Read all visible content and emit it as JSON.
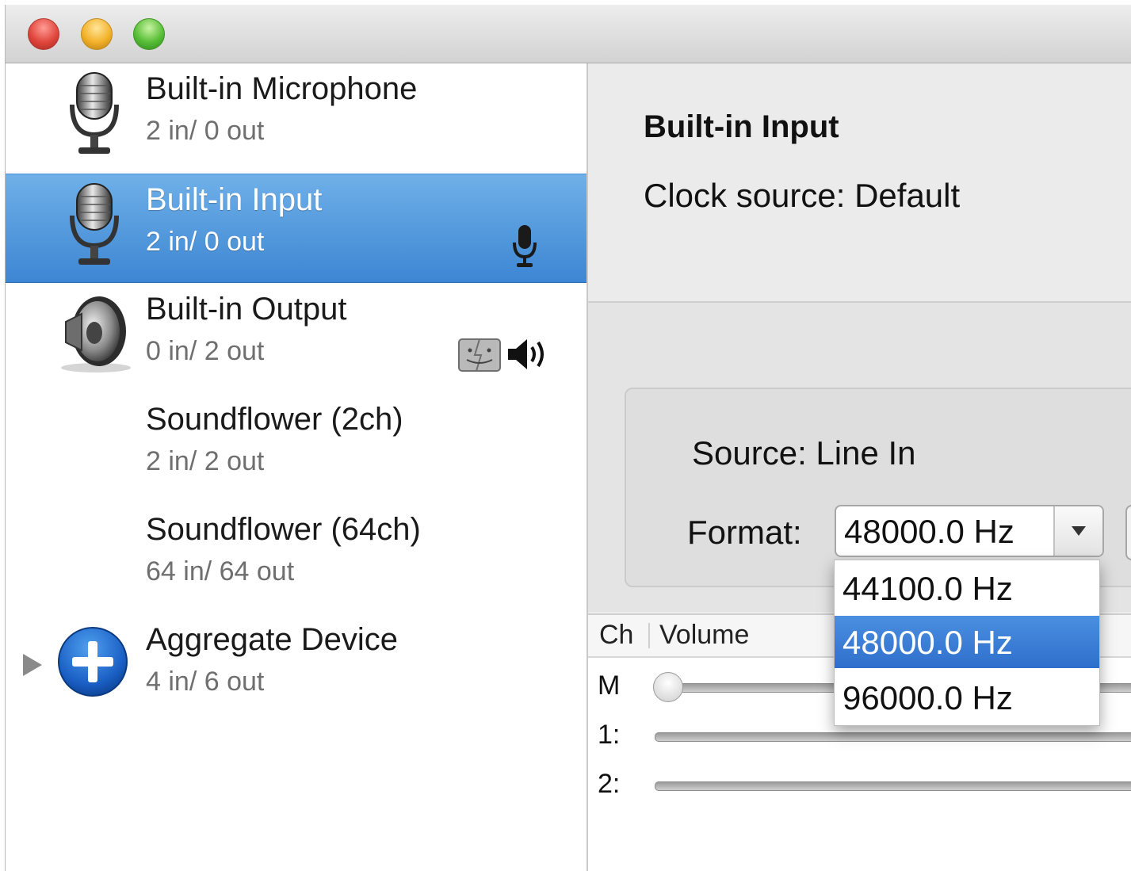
{
  "window": {
    "controls": [
      "close",
      "minimize",
      "zoom"
    ]
  },
  "sidebar": {
    "devices": [
      {
        "name": "Built-in Microphone",
        "io": "2 in/ 0 out",
        "icon": "microphone-icon",
        "selected": false
      },
      {
        "name": "Built-in Input",
        "io": "2 in/ 0 out",
        "icon": "microphone-icon",
        "selected": true,
        "status_icons": [
          "default-input-mic-icon"
        ]
      },
      {
        "name": "Built-in Output",
        "io": "0 in/ 2 out",
        "icon": "speaker-icon",
        "selected": false,
        "status_icons": [
          "finder-system-output-icon",
          "default-output-speaker-icon"
        ]
      },
      {
        "name": "Soundflower (2ch)",
        "io": "2 in/ 2 out",
        "icon": "",
        "selected": false
      },
      {
        "name": "Soundflower (64ch)",
        "io": "64 in/ 64 out",
        "icon": "",
        "selected": false
      },
      {
        "name": "Aggregate Device",
        "io": "4 in/ 6 out",
        "icon": "plus-circle-icon",
        "selected": false,
        "expandable": true
      }
    ]
  },
  "detail": {
    "title": "Built-in Input",
    "clock_source": "Clock source:  Default",
    "source": "Source:  Line In",
    "format_label": "Format:",
    "format_value": "48000.0 Hz",
    "format_options": [
      "44100.0 Hz",
      "48000.0 Hz",
      "96000.0 Hz"
    ],
    "format_highlighted_index": 1
  },
  "channels": {
    "headers": {
      "ch": "Ch",
      "volume": "Volume"
    },
    "rows": [
      {
        "label": "M",
        "volume": 0.0
      },
      {
        "label": "1:",
        "volume": null
      },
      {
        "label": "2:",
        "volume": null
      }
    ]
  },
  "colors": {
    "selection_blue": "#3d86d3",
    "menu_highlight": "#2f6fcc"
  }
}
